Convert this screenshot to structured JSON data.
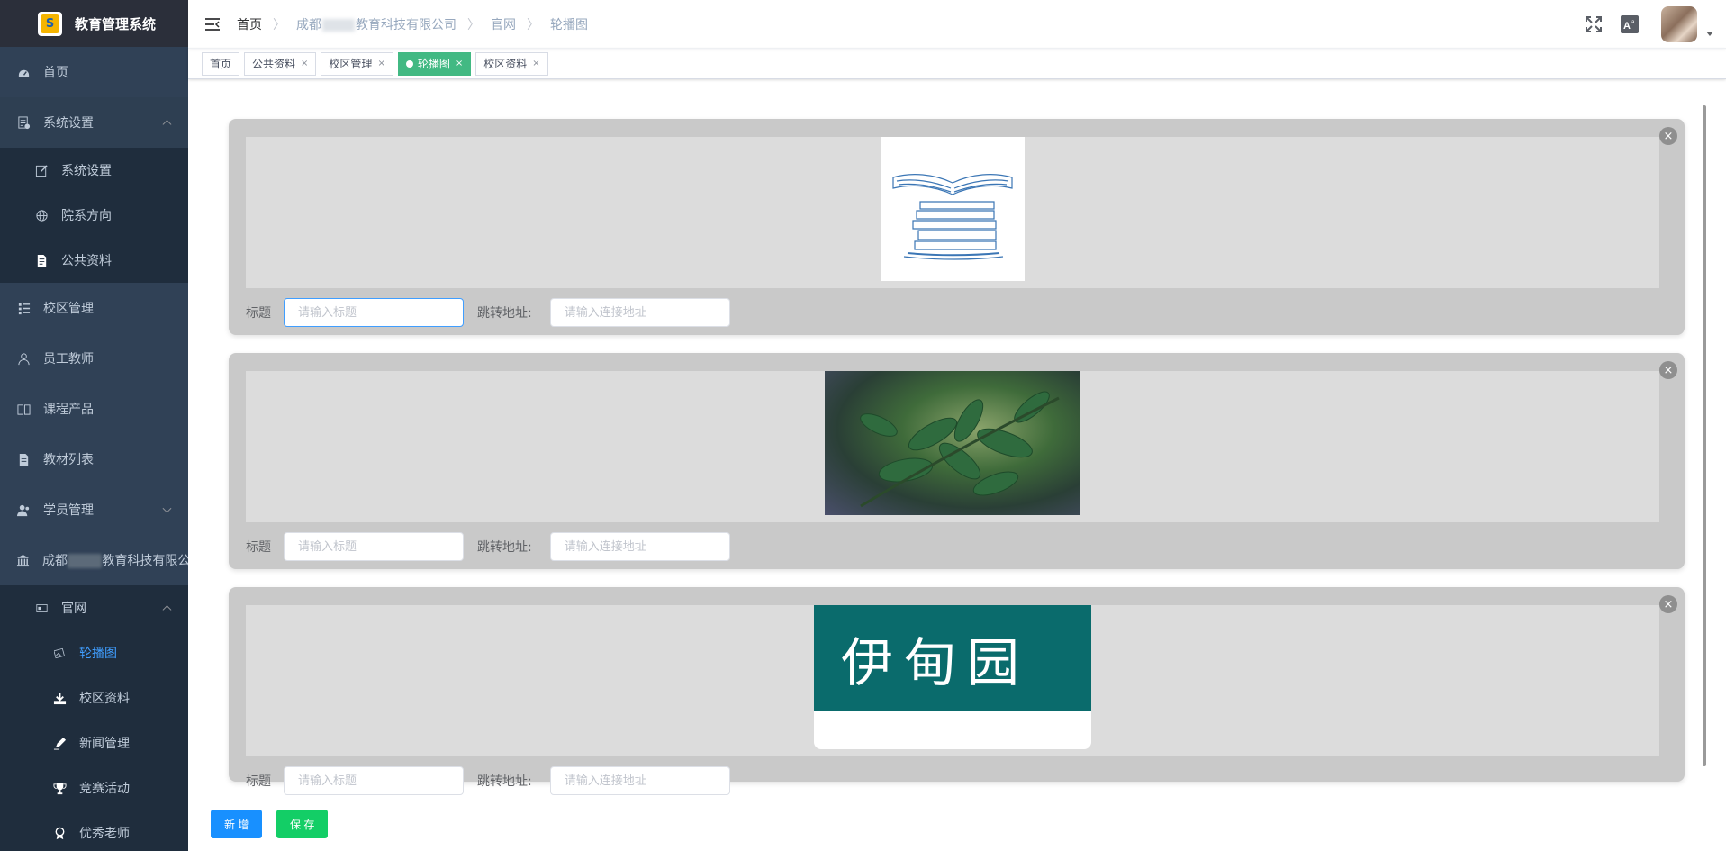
{
  "app": {
    "title": "教育管理系统",
    "logo_letter": "S"
  },
  "sidebar": {
    "items": [
      {
        "label": "首页",
        "icon": "dashboard-icon"
      },
      {
        "label": "系统设置",
        "icon": "settings-doc-icon",
        "expanded": true,
        "children": [
          {
            "label": "系统设置",
            "icon": "edit-icon"
          },
          {
            "label": "院系方向",
            "icon": "globe-icon"
          },
          {
            "label": "公共资料",
            "icon": "document-icon"
          }
        ]
      },
      {
        "label": "校区管理",
        "icon": "tree-list-icon"
      },
      {
        "label": "员工教师",
        "icon": "user-icon"
      },
      {
        "label": "课程产品",
        "icon": "book-icon"
      },
      {
        "label": "教材列表",
        "icon": "file-icon"
      },
      {
        "label": "学员管理",
        "icon": "users-icon",
        "expanded": false
      },
      {
        "label_prefix": "成都",
        "label_suffix": "教育科技有限公司",
        "icon": "bank-icon",
        "expanded": true,
        "children": [
          {
            "label": "官网",
            "icon": "browser-icon",
            "expanded": true,
            "children": [
              {
                "label": "轮播图",
                "icon": "image-icon",
                "active": true
              },
              {
                "label": "校区资料",
                "icon": "download-icon"
              },
              {
                "label": "新闻管理",
                "icon": "pen-icon"
              },
              {
                "label": "竞赛活动",
                "icon": "trophy-icon"
              },
              {
                "label": "优秀老师",
                "icon": "medal-icon"
              }
            ]
          }
        ]
      }
    ]
  },
  "navbar": {
    "breadcrumb": [
      {
        "label": "首页"
      },
      {
        "label_prefix": "成都",
        "label_suffix": "教育科技有限公司"
      },
      {
        "label": "官网"
      },
      {
        "label": "轮播图"
      }
    ],
    "icons": [
      "fullscreen-icon",
      "font-size-icon"
    ]
  },
  "tags": [
    {
      "label": "首页",
      "closable": false
    },
    {
      "label": "公共资料",
      "closable": true
    },
    {
      "label": "校区管理",
      "closable": true
    },
    {
      "label": "轮播图",
      "closable": true,
      "active": true
    },
    {
      "label": "校区资料",
      "closable": true
    }
  ],
  "close_symbol": "×",
  "carousel": {
    "title_label": "标题",
    "url_label": "跳转地址:",
    "title_placeholder": "请输入标题",
    "url_placeholder": "请输入连接地址",
    "items": [
      {
        "image": "books-sketch",
        "title": "",
        "url": ""
      },
      {
        "image": "green-leaves-photo",
        "title": "",
        "url": ""
      },
      {
        "image": "calligraphy-banner",
        "title": "",
        "url": "",
        "banner_text": "伊甸园"
      }
    ]
  },
  "buttons": {
    "add": "新 增",
    "save": "保 存"
  },
  "colors": {
    "sidebar_bg": "#304156",
    "active_menu": "#409eff",
    "active_tag": "#42b983",
    "btn_add": "#1890ff",
    "btn_save": "#13ce66",
    "banner_teal": "#0a6b6c"
  }
}
